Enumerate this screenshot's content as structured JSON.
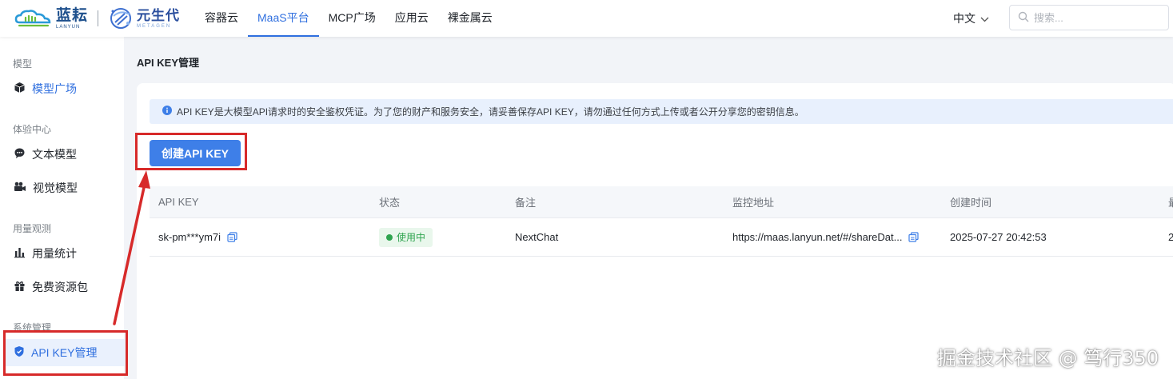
{
  "header": {
    "logo": {
      "name": "蓝耘",
      "en": "LANYUN"
    },
    "partner_logo": {
      "name": "元生代",
      "en": "METAGEN"
    },
    "nav": [
      {
        "label": "容器云",
        "active": false
      },
      {
        "label": "MaaS平台",
        "active": true
      },
      {
        "label": "MCP广场",
        "active": false
      },
      {
        "label": "应用云",
        "active": false
      },
      {
        "label": "裸金属云",
        "active": false
      }
    ],
    "language": "中文",
    "search_placeholder": "搜索..."
  },
  "sidebar": {
    "group_model": "模型",
    "item_model_square": "模型广场",
    "group_experience": "体验中心",
    "item_text_model": "文本模型",
    "item_vision_model": "视觉模型",
    "group_usage": "用量观测",
    "item_usage_stats": "用量统计",
    "item_free_pack": "免费资源包",
    "group_system": "系统管理",
    "item_api_key": "API KEY管理"
  },
  "main": {
    "title": "API KEY管理",
    "info": "API KEY是大模型API请求时的安全鉴权凭证。为了您的财产和服务安全，请妥善保存API KEY，请勿通过任何方式上传或者公开分享您的密钥信息。",
    "create_button": "创建API KEY",
    "table": {
      "columns": [
        "API KEY",
        "状态",
        "备注",
        "监控地址",
        "创建时间",
        "最"
      ],
      "row": {
        "api_key": "sk-pm***ym7i",
        "status": "使用中",
        "note": "NextChat",
        "monitor_url": "https://maas.lanyun.net/#/shareDat...",
        "created_at": "2025-07-27 20:42:53",
        "last": "2"
      }
    }
  },
  "watermark": "掘金技术社区 @ 笃行350",
  "colors": {
    "accent": "#2f6fdf",
    "button": "#3e7fe8",
    "annotation": "#d72a2a",
    "status_green": "#2fa44f"
  }
}
